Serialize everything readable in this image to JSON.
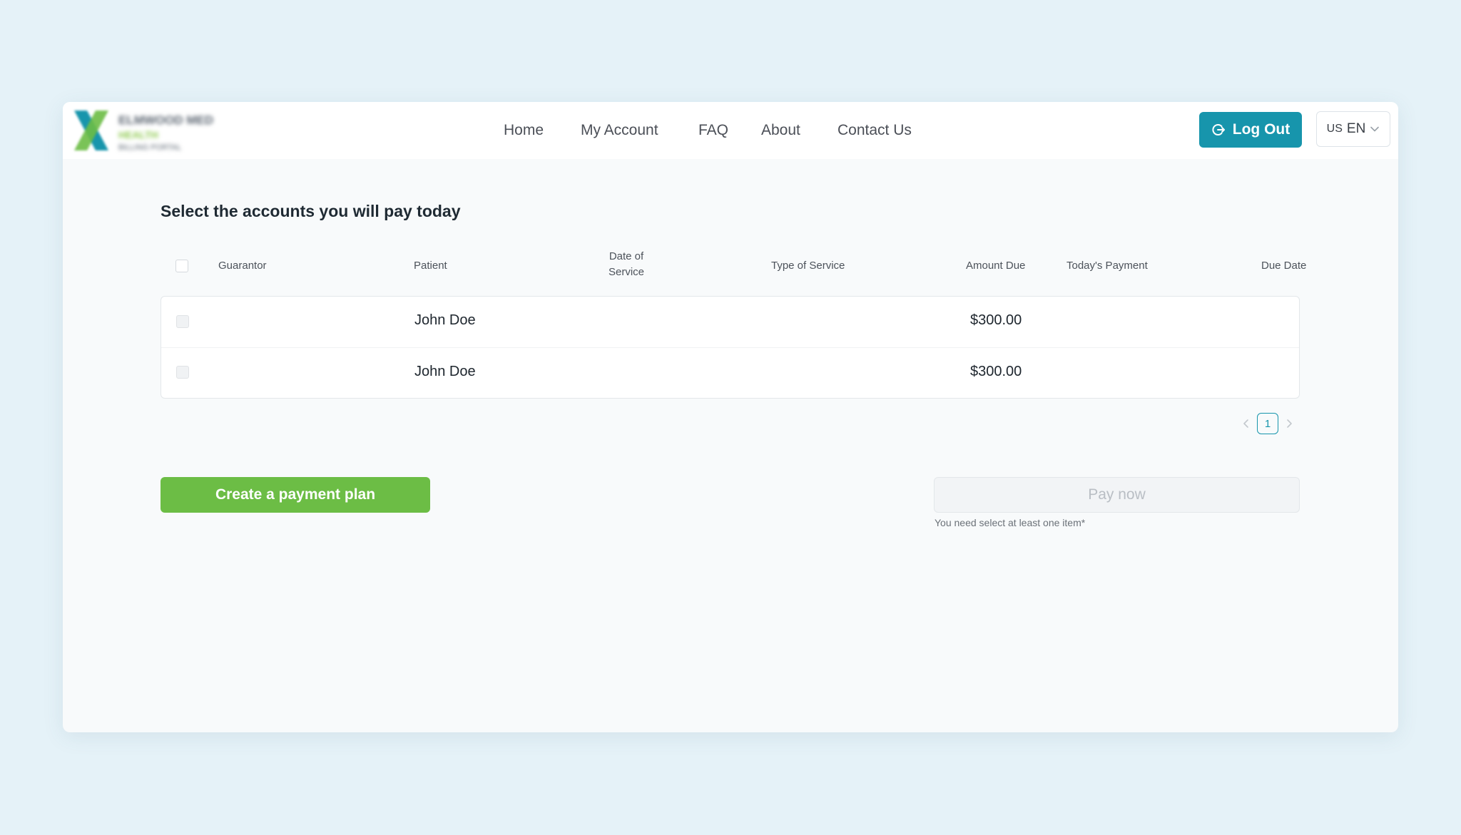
{
  "brand": {
    "logo_line1": "ELMWOOD MED",
    "logo_line2": "HEALTH",
    "logo_line3": "BILLING PORTAL",
    "colors": {
      "primary": "#1795ac",
      "accent_green": "#6cbd45",
      "background": "#e5f2f8"
    }
  },
  "nav": {
    "links": [
      "Home",
      "My Account",
      "FAQ",
      "About",
      "Contact Us"
    ],
    "logout_label": "Log Out",
    "logout_icon": "logout-icon",
    "language": {
      "flag": "US",
      "code": "EN",
      "icon": "chevron-down-icon"
    }
  },
  "main": {
    "title": "Select the accounts you will pay today",
    "table": {
      "columns": {
        "guarantor": "Guarantor",
        "patient": "Patient",
        "date_line1": "Date of",
        "date_line2": "Service",
        "type_of_service": "Type of Service",
        "amount_due": "Amount Due",
        "todays_payment": "Today's Payment",
        "due_date": "Due Date"
      },
      "rows": [
        {
          "guarantor": "",
          "patient": "John Doe",
          "date_of_service": "",
          "type_of_service": "",
          "amount_due": "$300.00",
          "todays_payment": "",
          "due_date": ""
        },
        {
          "guarantor": "",
          "patient": "John Doe",
          "date_of_service": "",
          "type_of_service": "",
          "amount_due": "$300.00",
          "todays_payment": "",
          "due_date": ""
        }
      ]
    },
    "pagination": {
      "current_page": "1"
    },
    "create_plan_label": "Create a payment plan",
    "pay_now_label": "Pay now",
    "pay_hint": "You need select at least one item*"
  }
}
